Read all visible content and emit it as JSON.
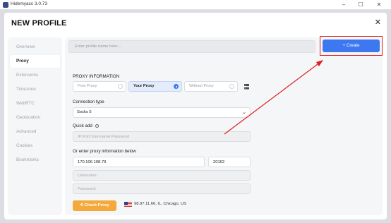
{
  "app": {
    "title": "Hidemyacc 3.0.73"
  },
  "window_controls": {
    "minimize": "–",
    "maximize": "☐",
    "close": "✕"
  },
  "page": {
    "title": "NEW PROFILE",
    "close": "✕"
  },
  "sidebar": {
    "items": [
      {
        "label": "Overview"
      },
      {
        "label": "Proxy",
        "active": true
      },
      {
        "label": "Extensions"
      },
      {
        "label": "Timezone"
      },
      {
        "label": "WebRTC"
      },
      {
        "label": "Geolocation"
      },
      {
        "label": "Advanced"
      },
      {
        "label": "Cookies"
      },
      {
        "label": "Bookmarks"
      }
    ]
  },
  "profile_name": {
    "placeholder": "Enter profile name here...",
    "value": ""
  },
  "create_button": {
    "label": "+ Create"
  },
  "proxy": {
    "section_title": "PROXY INFORMATION",
    "modes": [
      {
        "label": "Free Proxy",
        "selected": false
      },
      {
        "label": "Your Proxy",
        "selected": true
      },
      {
        "label": "Without Proxy",
        "selected": false
      }
    ],
    "connection_type_label": "Connection type",
    "connection_type_value": "Socks 5",
    "quick_add_label": "Quick add",
    "quick_add_placeholder": "IP:Port:Username:Password",
    "manual_label": "Or enter proxy information below",
    "host": "170.106.108.79",
    "port": "20162",
    "username_placeholder": "Username",
    "password_placeholder": "Password",
    "check_button": "Check Proxy",
    "check_result": "98.97.11.66, IL, Chicago, US"
  },
  "colors": {
    "accent": "#3e78f0",
    "check_button": "#f3a93b",
    "annotation": "#e11d1d"
  }
}
